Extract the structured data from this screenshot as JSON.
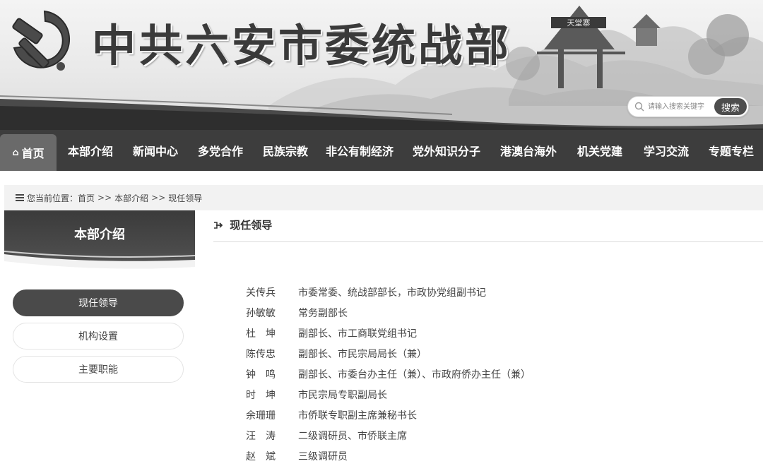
{
  "header": {
    "site_title": "中共六安市委统战部",
    "emblem_icon": "hammer-sickle-icon",
    "scenery_sign": "天堂寨",
    "search": {
      "placeholder": "请输入搜索关键字",
      "button_label": "搜索"
    }
  },
  "nav": {
    "items": [
      {
        "label": "首页",
        "icon": "home-icon",
        "active": true
      },
      {
        "label": "本部介绍"
      },
      {
        "label": "新闻中心"
      },
      {
        "label": "多党合作"
      },
      {
        "label": "民族宗教"
      },
      {
        "label": "非公有制经济"
      },
      {
        "label": "党外知识分子"
      },
      {
        "label": "港澳台海外"
      },
      {
        "label": "机关党建"
      },
      {
        "label": "学习交流"
      },
      {
        "label": "专题专栏"
      }
    ]
  },
  "breadcrumb": {
    "prefix": "您当前位置：",
    "items": [
      "首页",
      "本部介绍",
      "现任领导"
    ],
    "separator": ">>"
  },
  "sidebar": {
    "title": "本部介绍",
    "items": [
      {
        "label": "现任领导",
        "active": true
      },
      {
        "label": "机构设置"
      },
      {
        "label": "主要职能"
      }
    ]
  },
  "content": {
    "title": "现任领导",
    "leaders": [
      {
        "name": "关传兵",
        "title": "市委常委、统战部部长，市政协党组副书记"
      },
      {
        "name": "孙敏敏",
        "title": "常务副部长"
      },
      {
        "name": "杜坤",
        "title": "副部长、市工商联党组书记"
      },
      {
        "name": "陈传忠",
        "title": "副部长、市民宗局局长（兼）"
      },
      {
        "name": "钟鸣",
        "title": "副部长、市委台办主任（兼）、市政府侨办主任（兼）"
      },
      {
        "name": "时坤",
        "title": "市民宗局专职副局长"
      },
      {
        "name": "余珊珊",
        "title": "市侨联专职副主席兼秘书长"
      },
      {
        "name": "汪涛",
        "title": "二级调研员、市侨联主席"
      },
      {
        "name": "赵斌",
        "title": "三级调研员"
      }
    ]
  },
  "colors": {
    "nav_bg": "#3d3d3d",
    "nav_active": "#6a6a6a",
    "side_active": "#4a4a4a",
    "breadcrumb_bg": "#f2f2f2"
  }
}
